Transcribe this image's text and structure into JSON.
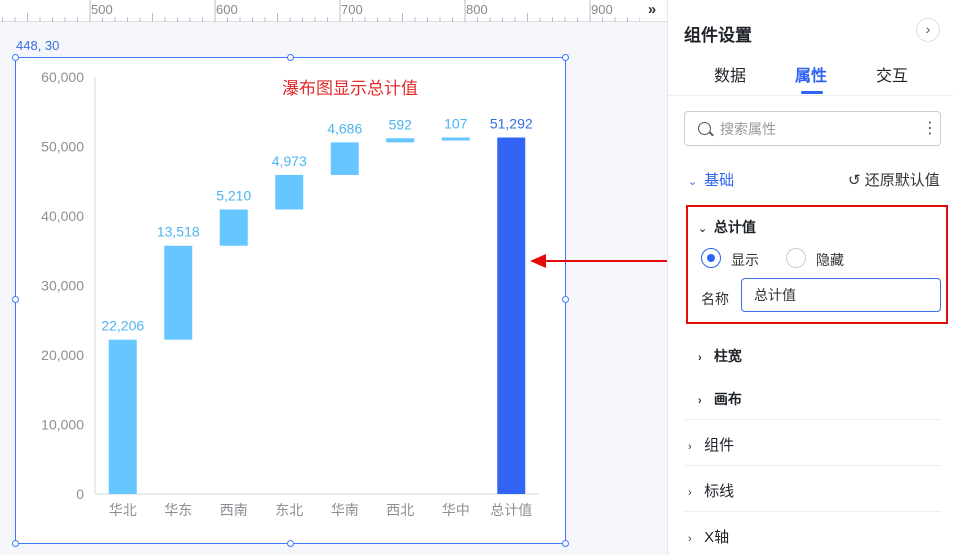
{
  "ruler": {
    "labels": [
      "500",
      "600",
      "700",
      "800",
      "900"
    ],
    "collapse_icon": "double-chevron-right-icon"
  },
  "canvas": {
    "coord_readout": "448, 30"
  },
  "chart_data": {
    "type": "bar",
    "subtype": "waterfall",
    "title": "瀑布图显示总计值",
    "categories": [
      "华北",
      "华东",
      "西南",
      "东北",
      "华南",
      "西北",
      "华中",
      "总计值"
    ],
    "increments": [
      22206,
      13518,
      5210,
      4973,
      4686,
      592,
      107
    ],
    "total": 51292,
    "data_labels": [
      "22,206",
      "13,518",
      "5,210",
      "4,973",
      "4,686",
      "592",
      "107",
      "51,292"
    ],
    "yticks": [
      "0",
      "10,000",
      "20,000",
      "30,000",
      "40,000",
      "50,000",
      "60,000"
    ],
    "ylim": [
      0,
      60000
    ],
    "xlabel": "",
    "ylabel": "",
    "colors": {
      "increment": "#66c6ff",
      "total": "#3264f6",
      "label": "#4db4ef",
      "title": "#e22b2b",
      "axis_text": "#8d8f94"
    },
    "grid": false,
    "legend": "none"
  },
  "panel": {
    "title": "组件设置",
    "close_icon": "chevron-right-circle-icon",
    "tabs": [
      {
        "label": "数据",
        "active": false
      },
      {
        "label": "属性",
        "active": true
      },
      {
        "label": "交互",
        "active": false
      }
    ],
    "search": {
      "placeholder": "搜索属性",
      "value": "",
      "more_icon": "vertical-dots-icon"
    },
    "section_basic": "基础",
    "reset_default": "还原默认值",
    "total_section": {
      "title": "总计值",
      "options": [
        {
          "label": "显示",
          "selected": true
        },
        {
          "label": "隐藏",
          "selected": false
        }
      ],
      "name_label": "名称",
      "name_value": "总计值"
    },
    "sub_sections": [
      "柱宽",
      "画布"
    ],
    "sections": [
      "组件",
      "标线",
      "X轴"
    ]
  },
  "accent_color": "#2e64f1",
  "highlight_color": "#e40a0a"
}
